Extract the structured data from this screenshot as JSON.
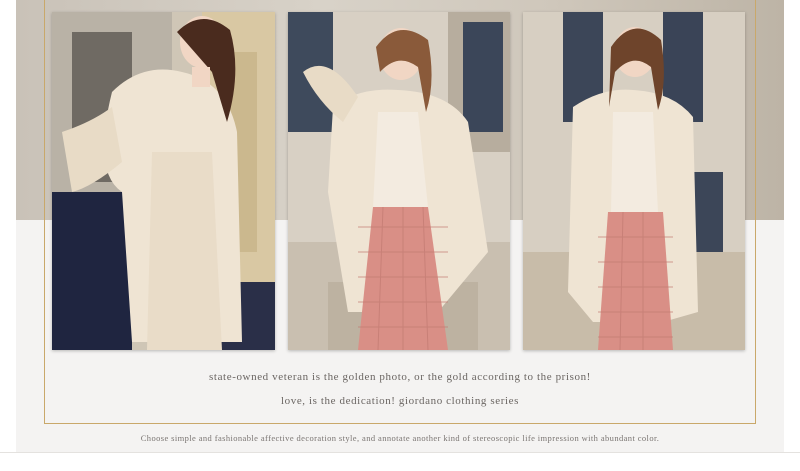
{
  "photos": [
    {
      "name": "model-photo-1",
      "alt": "model in beige blazer and trousers"
    },
    {
      "name": "model-photo-2",
      "alt": "model in beige blazer and plaid skirt"
    },
    {
      "name": "model-photo-3",
      "alt": "model in beige blazer with plaid skirt"
    }
  ],
  "captions": {
    "line1": "state-owned veteran is the golden photo, or the gold according to the prison!",
    "line2": "love, is the dedication! giordano clothing series",
    "line3": "Choose simple and fashionable affective decoration style, and annotate another kind of stereoscopic life impression with abundant color."
  },
  "colors": {
    "accent_gold": "#c9a86a",
    "background": "#f4f3f2",
    "blazer": "#efe4d3",
    "plaid": "#d98f86",
    "text": "#6a6562"
  }
}
